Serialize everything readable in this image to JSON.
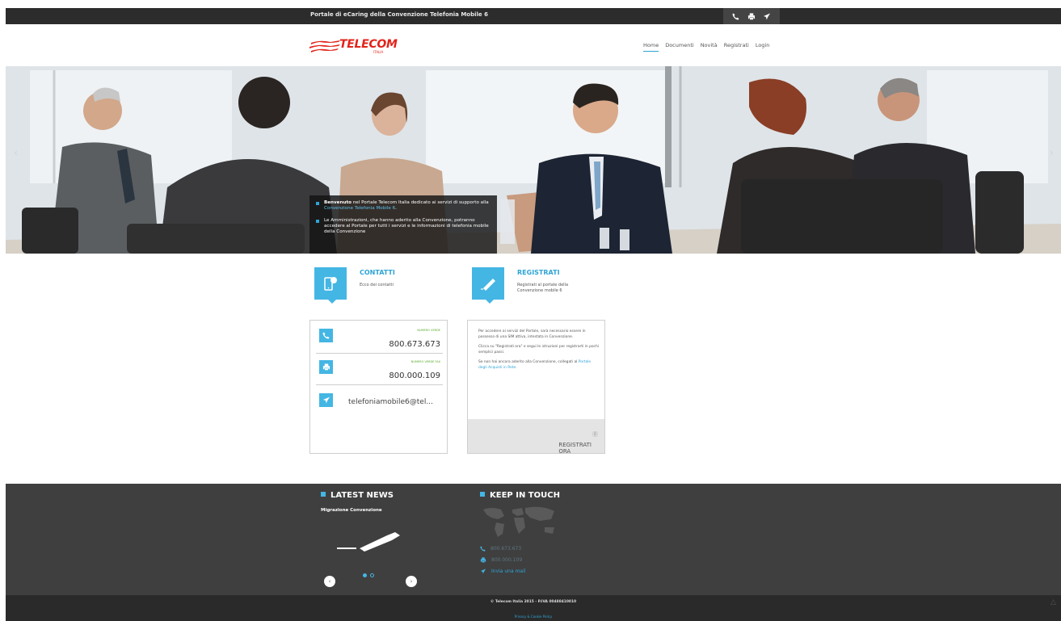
{
  "topbar": {
    "title": "Portale di eCaring della Convenzione Telefonia Mobile 6",
    "icons": [
      "phone-icon",
      "fax-icon",
      "send-icon"
    ]
  },
  "header": {
    "logo_text": "TELECOM",
    "logo_sub": "ITALIA",
    "nav": [
      "Home",
      "Documenti",
      "Novità",
      "Registrati",
      "Login"
    ]
  },
  "hero": {
    "caption_1_bold": "Benvenuto",
    "caption_1_text": " nel Portale Telecom Italia dedicato ai servizi di supporto alla ",
    "caption_1_link": "Convenzione Telefonia Mobile 6",
    "caption_1_end": ".",
    "caption_2": "Le Amministrazioni, che hanno aderito alla Convenzione, potranno accedere al Portale per tutti i servizi e le informazioni di telefonia mobile della Convenzione"
  },
  "contatti": {
    "title": "CONTATTI",
    "desc": "Ecco dei contatti",
    "rows": [
      {
        "label": "NUMERO VERDE",
        "value": "800.673.673"
      },
      {
        "label": "NUMERO VERDE FAX",
        "value": "800.000.109"
      }
    ],
    "email": "telefoniamobile6@tel..."
  },
  "registrati": {
    "title": "REGISTRATI",
    "desc": "Registrati al portale della Convenzione mobile 6",
    "p1": "Per accedere ai servizi del Portale, sarà necessario essere in possesso di una SIM attiva, intestata in Convenzione.",
    "p2": "Clicca su \"Registrati ora\" e segui le istruzioni per registrarti in pochi semplici passi.",
    "p3_text": "Se non hai ancora aderito alla Convenzione, collegati al ",
    "p3_link": "Portale degli Acquisti in Rete",
    "p3_end": ".",
    "button": "REGISTRATI ORA"
  },
  "footer": {
    "news_title": "LATEST NEWS",
    "news_item": "Migrazione Convenzione",
    "keep_title": "KEEP IN TOUCH",
    "phone": "800.673.673",
    "fax": "800.000.109",
    "mail_link": "Invia una mail",
    "copyright": "© Telecom Italia 2015 - P.IVA 00488410010",
    "privacy": "Privacy & Cookie Policy"
  },
  "colors": {
    "accent": "#44b6e4",
    "brand": "#e2231a",
    "footer_bg": "#3f3f3f"
  }
}
